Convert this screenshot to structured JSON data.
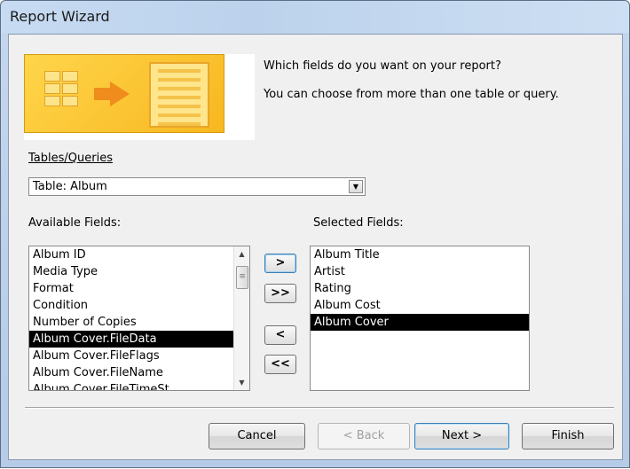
{
  "window": {
    "title": "Report Wizard"
  },
  "header": {
    "question": "Which fields do you want on your report?",
    "hint": "You can choose from more than one table or query."
  },
  "tables_queries": {
    "label": "Tables/Queries",
    "value": "Table: Album"
  },
  "available_fields": {
    "label": "Available Fields:",
    "items": [
      "Album ID",
      "Media Type",
      "Format",
      "Condition",
      "Number of Copies",
      "Album Cover.FileData",
      "Album Cover.FileFlags",
      "Album Cover.FileName",
      "Album Cover.FileTimeSt..."
    ],
    "selected_index": 5
  },
  "selected_fields": {
    "label": "Selected Fields:",
    "items": [
      "Album Title",
      "Artist",
      "Rating",
      "Album Cost",
      "Album Cover"
    ],
    "selected_index": 4
  },
  "move_buttons": {
    "add_one": ">",
    "add_all": ">>",
    "remove_one": "<",
    "remove_all": "<<"
  },
  "footer": {
    "cancel": "Cancel",
    "back": "< Back",
    "next": "Next >",
    "finish": "Finish"
  }
}
